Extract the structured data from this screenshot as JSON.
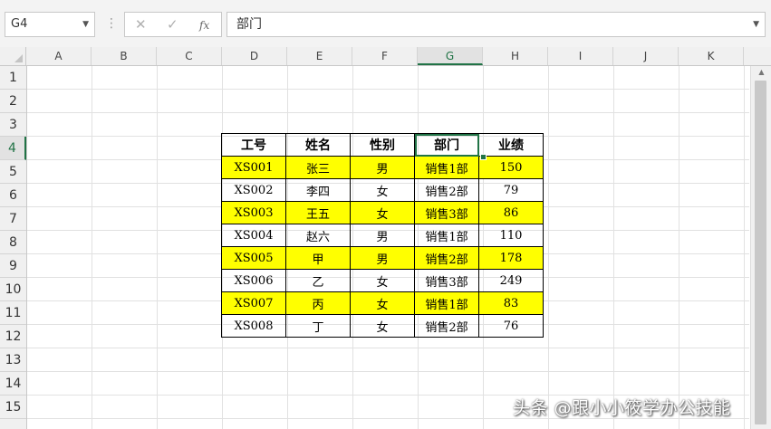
{
  "formula_bar": {
    "name_box": "G4",
    "cancel_symbol": "✕",
    "enter_symbol": "✓",
    "fx_label": "fx",
    "content": "部门"
  },
  "columns": [
    "A",
    "B",
    "C",
    "D",
    "E",
    "F",
    "G",
    "H",
    "I",
    "J",
    "K"
  ],
  "selected_column": "G",
  "rows": [
    "1",
    "2",
    "3",
    "4",
    "5",
    "6",
    "7",
    "8",
    "9",
    "10",
    "11",
    "12",
    "13",
    "14",
    "15"
  ],
  "selected_row": "4",
  "table": {
    "headers": [
      "工号",
      "姓名",
      "性别",
      "部门",
      "业绩"
    ],
    "rows": [
      [
        "XS001",
        "张三",
        "男",
        "销售1部",
        "150"
      ],
      [
        "XS002",
        "李四",
        "女",
        "销售2部",
        "79"
      ],
      [
        "XS003",
        "王五",
        "女",
        "销售3部",
        "86"
      ],
      [
        "XS004",
        "赵六",
        "男",
        "销售1部",
        "110"
      ],
      [
        "XS005",
        "甲",
        "男",
        "销售2部",
        "178"
      ],
      [
        "XS006",
        "乙",
        "女",
        "销售3部",
        "249"
      ],
      [
        "XS007",
        "丙",
        "女",
        "销售1部",
        "83"
      ],
      [
        "XS008",
        "丁",
        "女",
        "销售2部",
        "76"
      ]
    ],
    "highlight_color": "#ffff00",
    "accent_color": "#217346"
  },
  "watermark": "头条 @跟小小筱学办公技能"
}
